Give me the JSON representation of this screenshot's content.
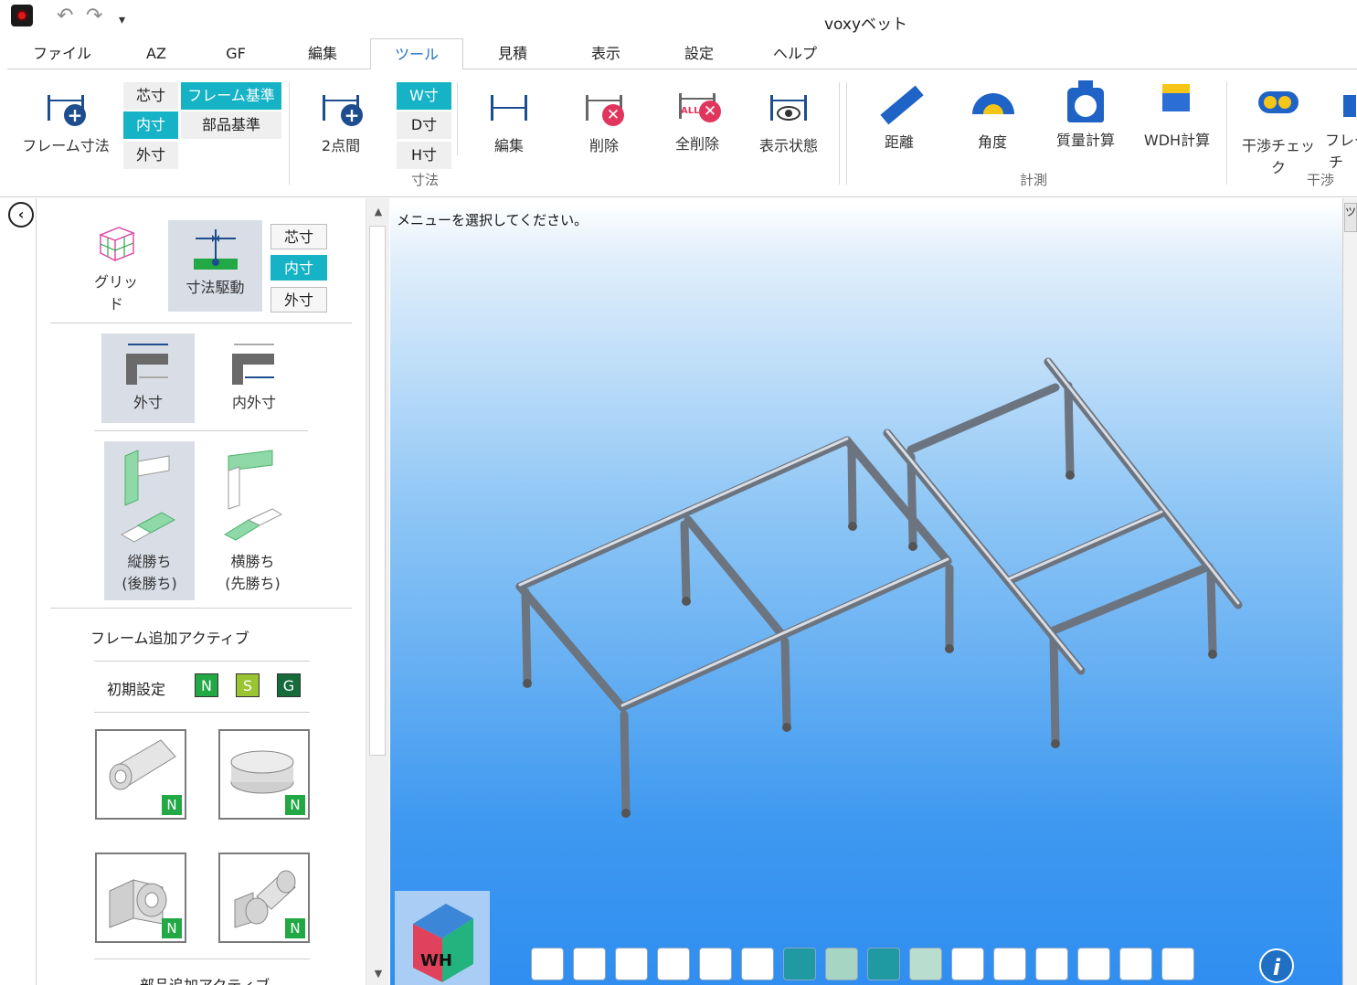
{
  "window": {
    "title": "voxyベット"
  },
  "menu": {
    "tabs": [
      {
        "label": "ファイル"
      },
      {
        "label": "AZ"
      },
      {
        "label": "GF"
      },
      {
        "label": "編集"
      },
      {
        "label": "ツール"
      },
      {
        "label": "見積"
      },
      {
        "label": "表示"
      },
      {
        "label": "設定"
      },
      {
        "label": "ヘルプ"
      }
    ],
    "active": "ツール"
  },
  "ribbon": {
    "frame_dim": "フレーム寸法",
    "core": "芯寸",
    "inner": "内寸",
    "outer": "外寸",
    "frame_base": "フレーム基準",
    "part_base": "部品基準",
    "two_point": "2点間",
    "w": "W寸",
    "d": "D寸",
    "h": "H寸",
    "edit": "編集",
    "delete": "削除",
    "delete_all": "全削除",
    "display_state": "表示状態",
    "group_dim": "寸法",
    "distance": "距離",
    "angle": "角度",
    "mass": "質量計算",
    "wdh": "WDH計算",
    "group_measure": "計測",
    "interference": "干渉チェック",
    "frame_cut1": "フレー",
    "frame_cut2": "チ",
    "group_interference": "干渉",
    "all_label": "ALL"
  },
  "panel": {
    "grid": "グリッド",
    "dim_drive": "寸法駆動",
    "core": "芯寸",
    "inner": "内寸",
    "outer": "外寸",
    "outer_dim": "外寸",
    "inner_outer_dim": "内外寸",
    "vert_win": "縦勝ち",
    "vert_win_sub": "(後勝ち)",
    "horiz_win": "横勝ち",
    "horiz_win_sub": "(先勝ち)",
    "frame_add_active": "フレーム追加アクティブ",
    "initial_setting": "初期設定",
    "badge_n": "N",
    "badge_s": "S",
    "badge_g": "G",
    "part_badge": "N",
    "part_add_active": "部品追加アクティブ"
  },
  "viewport": {
    "message": "メニューを選択してください。",
    "cube_label": "WH",
    "info": "i"
  },
  "right_strip": {
    "tab": "ツ"
  }
}
